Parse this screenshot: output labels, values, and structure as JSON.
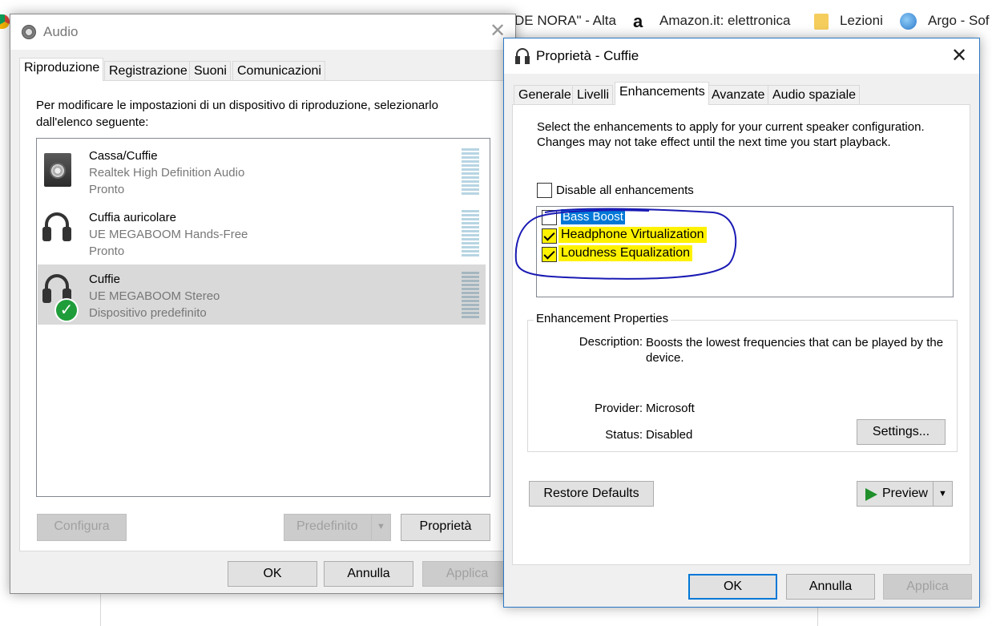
{
  "browser": {
    "bookmark_partial": "DE NORA\" - Alta",
    "bookmark_amazon": "Amazon.it: elettronica",
    "bookmark_lezioni": "Lezioni",
    "bookmark_argo": "Argo - Sof"
  },
  "audio": {
    "title": "Audio",
    "tabs": [
      "Riproduzione",
      "Registrazione",
      "Suoni",
      "Comunicazioni"
    ],
    "instruction": "Per modificare le impostazioni di un dispositivo di riproduzione, selezionarlo dall'elenco seguente:",
    "devices": [
      {
        "name": "Cassa/Cuffie",
        "driver": "Realtek High Definition Audio",
        "status": "Pronto"
      },
      {
        "name": "Cuffia auricolare",
        "driver": "UE MEGABOOM Hands-Free",
        "status": "Pronto"
      },
      {
        "name": "Cuffie",
        "driver": "UE MEGABOOM Stereo",
        "status": "Dispositivo predefinito"
      }
    ],
    "buttons": {
      "configura": "Configura",
      "predefinito": "Predefinito",
      "proprieta": "Proprietà",
      "ok": "OK",
      "annulla": "Annulla",
      "applica": "Applica"
    }
  },
  "props": {
    "title": "Proprietà - Cuffie",
    "tabs": [
      "Generale",
      "Livelli",
      "Enhancements",
      "Avanzate",
      "Audio spaziale"
    ],
    "active_tab": "Enhancements",
    "intro": "Select the enhancements to apply for your current speaker configuration. Changes may not take effect until the next time you start playback.",
    "disable_all": {
      "label": "Disable all enhancements",
      "checked": false
    },
    "enhancements": [
      {
        "label": "Bass Boost",
        "checked": false,
        "selected": true
      },
      {
        "label": "Headphone Virtualization",
        "checked": true
      },
      {
        "label": "Loudness Equalization",
        "checked": true
      }
    ],
    "group_label": "Enhancement Properties",
    "description_label": "Description:",
    "description_value": "Boosts the lowest frequencies that can be played by the device.",
    "provider_label": "Provider:",
    "provider_value": "Microsoft",
    "status_label": "Status:",
    "status_value": "Disabled",
    "buttons": {
      "settings": "Settings...",
      "restore": "Restore Defaults",
      "preview": "Preview",
      "ok": "OK",
      "annulla": "Annulla",
      "applica": "Applica"
    }
  },
  "colors": {
    "annotation": "#1a1ab4",
    "highlight": "#fff200",
    "selection": "#0078d7"
  }
}
